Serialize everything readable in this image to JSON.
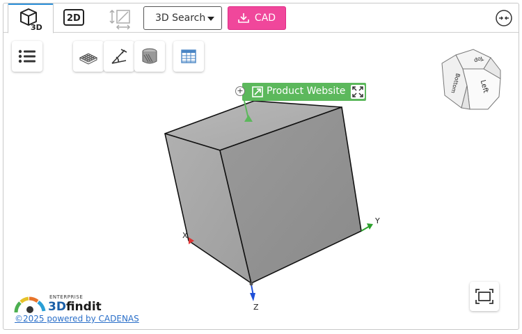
{
  "toolbar": {
    "tab_2d_label": "2D",
    "search_dropdown_label": "3D Search",
    "cad_button_label": "CAD"
  },
  "viewer": {
    "label_text": "Product Website",
    "axes": {
      "x": "X",
      "y": "Y",
      "z": "Z"
    },
    "viewcube_faces": {
      "left": "Left",
      "bottom": "Bottom",
      "top": "Top"
    }
  },
  "footer": {
    "brand_tag": "ENTERPRISE",
    "brand_name_prefix": "3D",
    "brand_name_suffix": "findit",
    "copyright": "©2025 powered by CADENAS"
  },
  "colors": {
    "accent": "#2a8fd8",
    "cad_button": "#f0479b",
    "label": "#5cb85c",
    "link": "#2a6fc9"
  },
  "icons": {
    "tab_3d": "cube-3d-icon",
    "measure": "measure-icon",
    "cad_download": "download-icon",
    "collapse": "collapse-arrows-icon",
    "list": "list-icon",
    "wireframe": "wireframe-icon",
    "dimension": "dimension-icon",
    "section": "section-cut-icon",
    "table": "table-icon",
    "fullscreen": "fullscreen-icon",
    "fit": "fit-view-icon",
    "external_link": "external-link-icon"
  }
}
